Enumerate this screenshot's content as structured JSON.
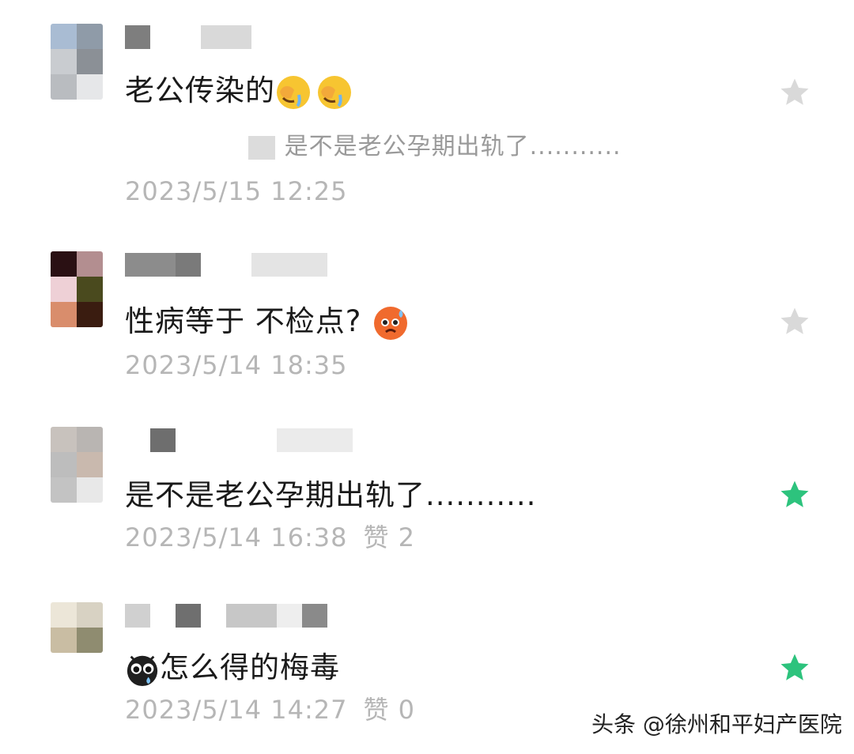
{
  "comments": [
    {
      "text": "老公传染的",
      "reply": ": 是不是老公孕期出轨了...........",
      "time": "2023/5/15 12:25",
      "likes": "",
      "liked": false
    },
    {
      "text": "性病等于 不检点?",
      "reply": "",
      "time": "2023/5/14 18:35",
      "likes": "",
      "liked": false
    },
    {
      "text": "是不是老公孕期出轨了...........",
      "reply": "",
      "time": "2023/5/14 16:38",
      "likes": "赞 2",
      "liked": true
    },
    {
      "text": "怎么得的梅毒",
      "reply": "",
      "time": "2023/5/14 14:27",
      "likes": "赞 0",
      "liked": true
    }
  ],
  "watermark": "头条 @徐州和平妇产医院",
  "colors": {
    "star_off": "#d9d9d9",
    "star_on": "#2dc37d",
    "time_text": "#b6b6b6"
  },
  "icons": [
    "facepalm-crying-emoji",
    "anxious-sweat-emoji",
    "crying-eyes-emoji",
    "star-icon"
  ]
}
